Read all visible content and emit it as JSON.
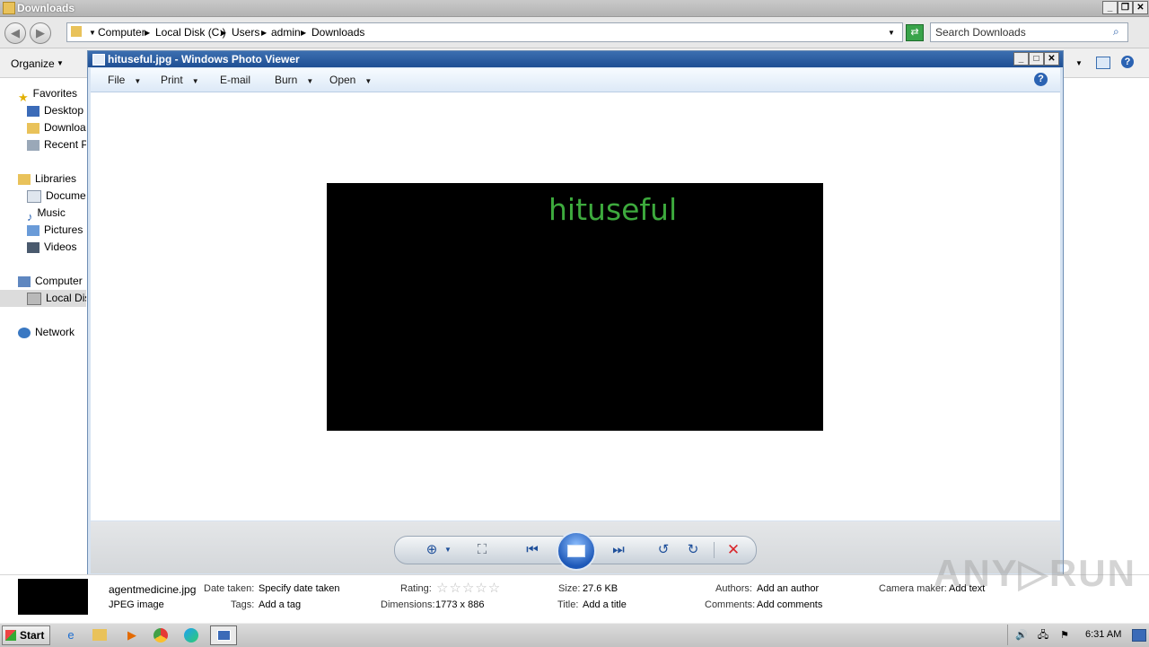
{
  "explorer": {
    "title": "Downloads",
    "breadcrumbs": [
      "Computer",
      "Local Disk (C:)",
      "Users",
      "admin",
      "Downloads"
    ],
    "search_placeholder": "Search Downloads",
    "organize_label": "Organize",
    "nav": {
      "favorites": "Favorites",
      "desktop": "Desktop",
      "downloads": "Downloac",
      "recent": "Recent Pl",
      "libraries": "Libraries",
      "documents": "Documen",
      "music": "Music",
      "pictures": "Pictures",
      "videos": "Videos",
      "computer": "Computer",
      "local_disk": "Local Disk",
      "network": "Network"
    }
  },
  "photo_viewer": {
    "title": "hituseful.jpg - Windows Photo Viewer",
    "menu": {
      "file": "File",
      "print": "Print",
      "email": "E-mail",
      "burn": "Burn",
      "open": "Open"
    },
    "image_text": "hituseful"
  },
  "details": {
    "filename": "agentmedicine.jpg",
    "filetype": "JPEG image",
    "date_label": "Date taken:",
    "date_value": "Specify date taken",
    "tags_label": "Tags:",
    "tags_value": "Add a tag",
    "rating_label": "Rating:",
    "rating_value": 0,
    "dimensions_label": "Dimensions:",
    "dimensions_value": "1773 x 886",
    "size_label": "Size:",
    "size_value": "27.6 KB",
    "title_label": "Title:",
    "title_value": "Add a title",
    "authors_label": "Authors:",
    "authors_value": "Add an author",
    "comments_label": "Comments:",
    "comments_value": "Add comments",
    "camera_label": "Camera maker:",
    "camera_value": "Add text"
  },
  "taskbar": {
    "start_label": "Start",
    "clock": "6:31 AM"
  },
  "watermark": "ANY.RUN",
  "colors": {
    "image_text": "#3daa3d",
    "title_bar": "#1f4f94",
    "close_icon": "#d9262b"
  }
}
